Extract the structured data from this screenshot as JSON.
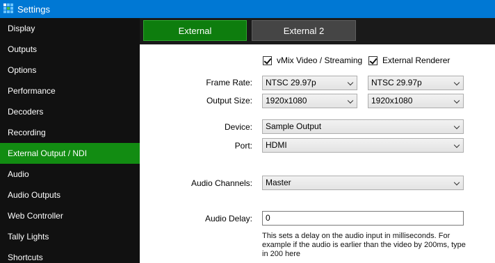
{
  "window": {
    "title": "Settings"
  },
  "sidebar": {
    "items": [
      {
        "label": "Display"
      },
      {
        "label": "Outputs"
      },
      {
        "label": "Options"
      },
      {
        "label": "Performance"
      },
      {
        "label": "Decoders"
      },
      {
        "label": "Recording"
      },
      {
        "label": "External Output / NDI",
        "active": true
      },
      {
        "label": "Audio"
      },
      {
        "label": "Audio Outputs"
      },
      {
        "label": "Web Controller"
      },
      {
        "label": "Tally Lights"
      },
      {
        "label": "Shortcuts"
      }
    ]
  },
  "tabs": [
    {
      "label": "External",
      "active": true
    },
    {
      "label": "External 2"
    }
  ],
  "form": {
    "checkbox_vmix": {
      "label": "vMix Video / Streaming",
      "checked": true
    },
    "checkbox_renderer": {
      "label": "External Renderer",
      "checked": true
    },
    "frame_rate": {
      "label": "Frame Rate:",
      "value_1": "NTSC 29.97p",
      "value_2": "NTSC 29.97p"
    },
    "output_size": {
      "label": "Output Size:",
      "value_1": "1920x1080",
      "value_2": "1920x1080"
    },
    "device": {
      "label": "Device:",
      "value": "Sample Output"
    },
    "port": {
      "label": "Port:",
      "value": "HDMI"
    },
    "audio_channels": {
      "label": "Audio Channels:",
      "value": "Master"
    },
    "audio_delay": {
      "label": "Audio Delay:",
      "value": "0",
      "help": "This sets a delay on the audio input in milliseconds. For example if the audio is earlier than the video by 200ms, type in 200 here"
    }
  },
  "colors": {
    "titlebar": "#0078d4",
    "sidebar_bg": "#111111",
    "active_green": "#128c12",
    "tab_inactive": "#454545"
  }
}
